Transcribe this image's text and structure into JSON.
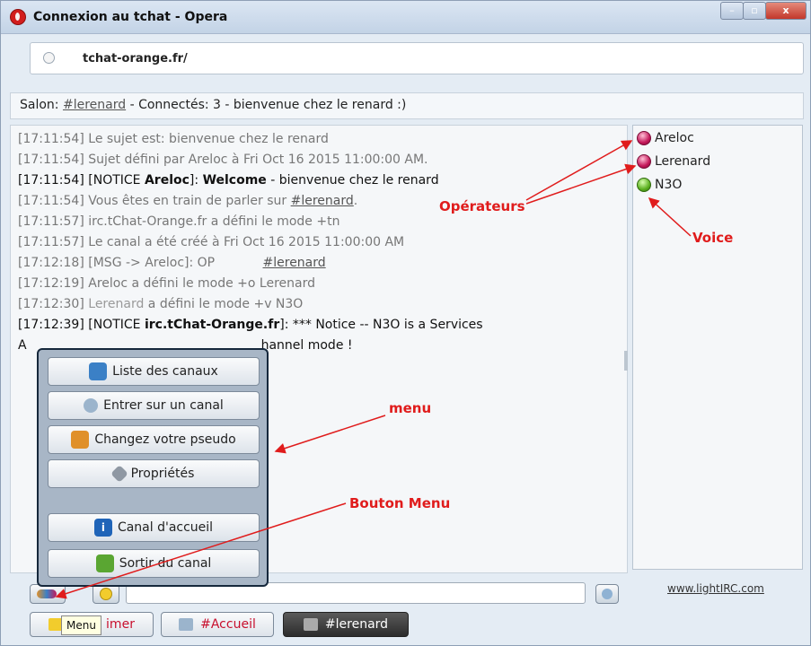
{
  "window": {
    "title": "Connexion au tchat - Opera",
    "controls": {
      "minimize": "–",
      "maximize": "▫",
      "close": "x"
    }
  },
  "address_bar": {
    "url": "tchat-orange.fr/"
  },
  "channel_bar": {
    "prefix": "Salon: ",
    "channel": "#lerenard",
    "suffix": " - Connectés: 3 - bienvenue chez le renard :)"
  },
  "chat_log": [
    {
      "time": "[17:11:54]",
      "text": " Le sujet est: bienvenue chez le renard"
    },
    {
      "time": "[17:11:54]",
      "text": " Sujet défini par Areloc à Fri Oct 16 2015 11:00:00 AM."
    },
    {
      "time": "[17:11:54]",
      "pre": " [NOTICE ",
      "nick": "Areloc",
      "mid": "]: ",
      "bold2": "Welcome",
      "post": " - bienvenue chez le renard"
    },
    {
      "time": "[17:11:54]",
      "pre": " Vous êtes en train de parler sur ",
      "link": "#lerenard",
      "post": "."
    },
    {
      "time": "[17:11:57]",
      "text": " irc.tChat-Orange.fr a défini le mode +tn"
    },
    {
      "time": "[17:11:57]",
      "text": " Le canal a été créé à Fri Oct 16 2015 11:00:00 AM"
    },
    {
      "time": "[17:12:18]",
      "pre": " [MSG -> Areloc]: OP            ",
      "link": "#lerenard"
    },
    {
      "time": "[17:12:19]",
      "text": " Areloc a défini le mode +o Lerenard"
    },
    {
      "time": "[17:12:30]",
      "pre": " ",
      "nick_gray": "Lerenard",
      "post": " a défini le mode +v N3O"
    },
    {
      "time": "[17:12:39]",
      "pre": " [NOTICE ",
      "nick": "irc.tChat-Orange.fr",
      "post": "]: *** Notice -- N3O is a Services"
    },
    {
      "cont_left": "A",
      "cont_right": "hannel mode !"
    }
  ],
  "users": [
    {
      "name": "Areloc",
      "status": "operator",
      "color": "#c4185a"
    },
    {
      "name": "Lerenard",
      "status": "operator",
      "color": "#c4185a"
    },
    {
      "name": "N3O",
      "status": "voice",
      "color": "#5cb020"
    }
  ],
  "menu": {
    "items": [
      {
        "label": "Liste des canaux",
        "icon": "channel-list-icon"
      },
      {
        "label": "Entrer sur un canal",
        "icon": "enter-channel-icon"
      },
      {
        "label": "Changez votre pseudo",
        "icon": "user-icon"
      },
      {
        "label": "Propriétés",
        "icon": "wrench-icon"
      },
      {
        "label": "Canal d'accueil",
        "icon": "info-icon"
      },
      {
        "label": "Sortir du canal",
        "icon": "exit-icon"
      }
    ]
  },
  "credit": "www.lightIRC.com",
  "tabs": [
    {
      "label": "imer",
      "color": "#c8102e"
    },
    {
      "label": "#Accueil",
      "color": "#c8102e"
    },
    {
      "label": "#lerenard",
      "color": "#ffffff",
      "active": true
    }
  ],
  "tooltip": "Menu",
  "annotations": {
    "operateurs": "Opérateurs",
    "voice": "Voice",
    "menu": "menu",
    "bouton_menu": "Bouton Menu",
    "color": "#e01c1c"
  }
}
